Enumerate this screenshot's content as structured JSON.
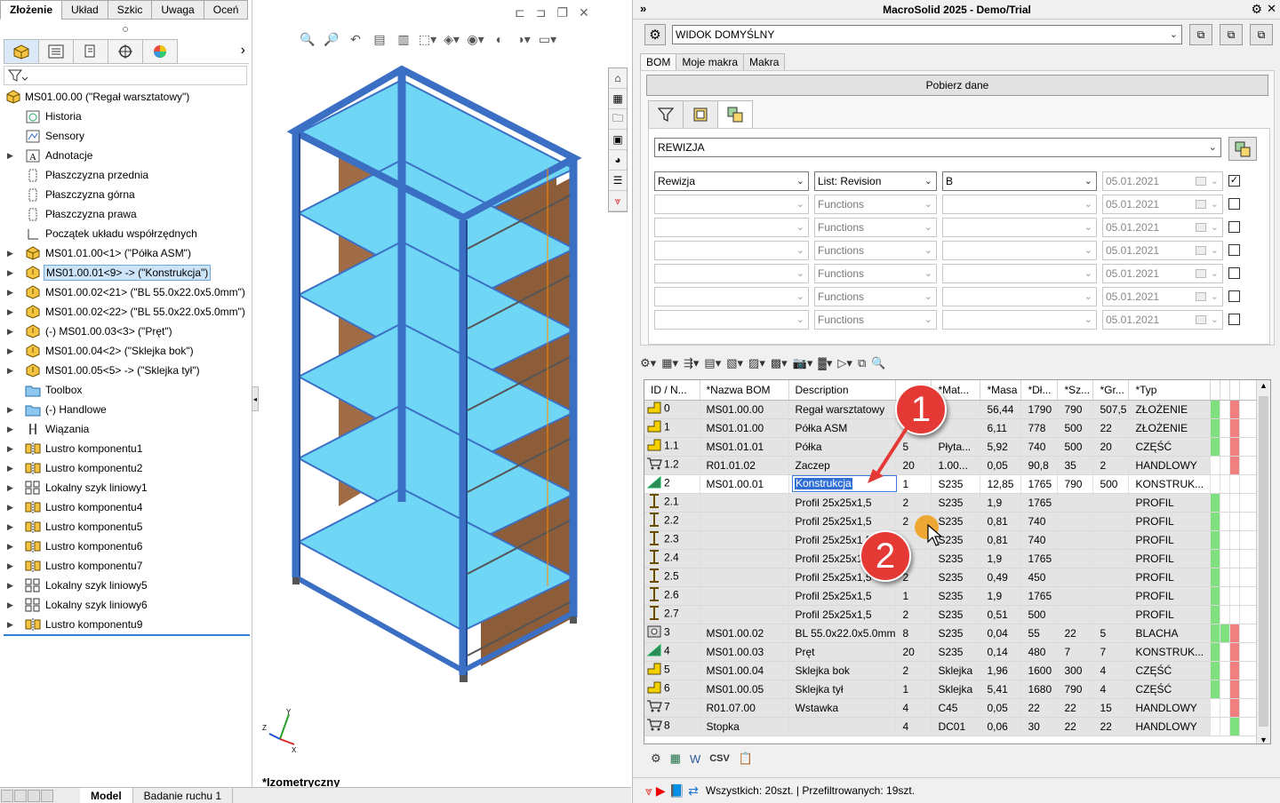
{
  "cmd_tabs": [
    "Złożenie",
    "Układ",
    "Szkic",
    "Uwaga",
    "Oceń"
  ],
  "tree": {
    "root": "MS01.00.00 (\"Regał warsztatowy\")",
    "items": [
      {
        "label": "Historia",
        "icon": "history-icon",
        "exp": ""
      },
      {
        "label": "Sensory",
        "icon": "sensor-icon",
        "exp": ""
      },
      {
        "label": "Adnotacje",
        "icon": "annotation-icon",
        "exp": "▶"
      },
      {
        "label": "Płaszczyzna przednia",
        "icon": "plane-icon",
        "exp": ""
      },
      {
        "label": "Płaszczyzna górna",
        "icon": "plane-icon",
        "exp": ""
      },
      {
        "label": "Płaszczyzna prawa",
        "icon": "plane-icon",
        "exp": ""
      },
      {
        "label": "Początek układu współrzędnych",
        "icon": "origin-icon",
        "exp": ""
      },
      {
        "label": "MS01.01.00<1> (\"Półka ASM\")",
        "icon": "assembly-icon",
        "exp": "▶"
      },
      {
        "label": "MS01.00.01<9> -> (\"Konstrukcja\")",
        "icon": "part-icon",
        "exp": "▶",
        "selected": true
      },
      {
        "label": "MS01.00.02<21> (\"BL 55.0x22.0x5.0mm\")",
        "icon": "part-icon",
        "exp": "▶"
      },
      {
        "label": "MS01.00.02<22> (\"BL 55.0x22.0x5.0mm\")",
        "icon": "part-icon",
        "exp": "▶"
      },
      {
        "label": "(-) MS01.00.03<3> (\"Pręt\")",
        "icon": "part-icon",
        "exp": "▶"
      },
      {
        "label": "MS01.00.04<2> (\"Sklejka bok\")",
        "icon": "part-icon",
        "exp": "▶"
      },
      {
        "label": "MS01.00.05<5> -> (\"Sklejka tył\")",
        "icon": "part-icon",
        "exp": "▶"
      },
      {
        "label": "Toolbox",
        "icon": "folder-icon",
        "exp": ""
      },
      {
        "label": "(-) Handlowe",
        "icon": "folder-icon",
        "exp": "▶"
      },
      {
        "label": "Wiązania",
        "icon": "mate-icon",
        "exp": "▶"
      },
      {
        "label": "Lustro komponentu1",
        "icon": "mirror-icon",
        "exp": "▶"
      },
      {
        "label": "Lustro komponentu2",
        "icon": "mirror-icon",
        "exp": "▶"
      },
      {
        "label": "Lokalny szyk liniowy1",
        "icon": "pattern-icon",
        "exp": "▶"
      },
      {
        "label": "Lustro komponentu4",
        "icon": "mirror-icon",
        "exp": "▶"
      },
      {
        "label": "Lustro komponentu5",
        "icon": "mirror-icon",
        "exp": "▶"
      },
      {
        "label": "Lustro komponentu6",
        "icon": "mirror-icon",
        "exp": "▶"
      },
      {
        "label": "Lustro komponentu7",
        "icon": "mirror-icon",
        "exp": "▶"
      },
      {
        "label": "Lokalny szyk liniowy5",
        "icon": "pattern-icon",
        "exp": "▶"
      },
      {
        "label": "Lokalny szyk liniowy6",
        "icon": "pattern-icon",
        "exp": "▶"
      },
      {
        "label": "Lustro komponentu9",
        "icon": "mirror-icon",
        "exp": "▶"
      }
    ]
  },
  "bottom_tabs": [
    "Model",
    "Badanie ruchu 1"
  ],
  "viewport": {
    "view_label": "*Izometryczny"
  },
  "panel": {
    "title": "MacroSolid 2025 - Demo/Trial",
    "view_combo": "WIDOK DOMYŚLNY",
    "tabs": [
      "BOM",
      "Moje makra",
      "Makra"
    ],
    "fetch_button": "Pobierz dane",
    "filter_combo": "REWIZJA",
    "filters": [
      {
        "field": "Rewizja",
        "op": "List: Revision",
        "value": "B",
        "date": "05.01.2021",
        "checked": true,
        "enabled": true
      },
      {
        "field": "",
        "op": "Functions",
        "value": "",
        "date": "05.01.2021",
        "checked": false,
        "enabled": false
      },
      {
        "field": "",
        "op": "Functions",
        "value": "",
        "date": "05.01.2021",
        "checked": false,
        "enabled": false
      },
      {
        "field": "",
        "op": "Functions",
        "value": "",
        "date": "05.01.2021",
        "checked": false,
        "enabled": false
      },
      {
        "field": "",
        "op": "Functions",
        "value": "",
        "date": "05.01.2021",
        "checked": false,
        "enabled": false
      },
      {
        "field": "",
        "op": "Functions",
        "value": "",
        "date": "05.01.2021",
        "checked": false,
        "enabled": false
      },
      {
        "field": "",
        "op": "Functions",
        "value": "",
        "date": "05.01.2021",
        "checked": false,
        "enabled": false
      }
    ],
    "grid": {
      "columns": [
        "ID / N...",
        "*Nazwa BOM",
        "Description",
        "",
        "*Mat...",
        "*Masa",
        "*Dł...",
        "*Sz...",
        "*Gr...",
        "*Typ"
      ],
      "rows": [
        {
          "icon": "part-icon",
          "id": "0",
          "name": "MS01.00.00",
          "desc": "Regał warsztatowy",
          "qty": "",
          "mat": "",
          "mass": "56,44",
          "len": "1790",
          "wid": "790",
          "thk": "507,5",
          "type": "ZŁOŻENIE",
          "s1": "g",
          "s2": "w",
          "s3": "r"
        },
        {
          "icon": "part-icon",
          "id": "1",
          "name": "MS01.01.00",
          "desc": "Półka ASM",
          "qty": "",
          "mat": "",
          "mass": "6,11",
          "len": "778",
          "wid": "500",
          "thk": "22",
          "type": "ZŁOŻENIE",
          "s1": "g",
          "s2": "w",
          "s3": "r"
        },
        {
          "icon": "part-icon",
          "id": "1.1",
          "name": "MS01.01.01",
          "desc": "Półka",
          "qty": "5",
          "mat": "Płyta...",
          "mass": "5,92",
          "len": "740",
          "wid": "500",
          "thk": "20",
          "type": "CZĘŚĆ",
          "s1": "g",
          "s2": "w",
          "s3": "r"
        },
        {
          "icon": "cart-icon",
          "id": "1.2",
          "name": "R01.01.02",
          "desc": "Zaczep",
          "qty": "20",
          "mat": "1.00...",
          "mass": "0,05",
          "len": "90,8",
          "wid": "35",
          "thk": "2",
          "type": "HANDLOWY",
          "s1": "w",
          "s2": "w",
          "s3": "r"
        },
        {
          "icon": "weldment-icon",
          "id": "2",
          "name": "MS01.00.01",
          "desc": "Konstrukcja",
          "qty": "1",
          "mat": "S235",
          "mass": "12,85",
          "len": "1765",
          "wid": "790",
          "thk": "500",
          "type": "KONSTRUK...",
          "s1": "w",
          "s2": "w",
          "s3": "w",
          "edit": true
        },
        {
          "icon": "beam-icon",
          "id": "2.1",
          "name": "",
          "desc": "Profil 25x25x1,5",
          "qty": "2",
          "mat": "S235",
          "mass": "1,9",
          "len": "1765",
          "wid": "",
          "thk": "",
          "type": "PROFIL",
          "s1": "g",
          "s2": "w",
          "s3": "w"
        },
        {
          "icon": "beam-icon",
          "id": "2.2",
          "name": "",
          "desc": "Profil 25x25x1,5",
          "qty": "2",
          "mat": "S235",
          "mass": "0,81",
          "len": "740",
          "wid": "",
          "thk": "",
          "type": "PROFIL",
          "s1": "g",
          "s2": "w",
          "s3": "w"
        },
        {
          "icon": "beam-icon",
          "id": "2.3",
          "name": "",
          "desc": "Profil 25x25x1,5",
          "qty": "",
          "mat": "S235",
          "mass": "0,81",
          "len": "740",
          "wid": "",
          "thk": "",
          "type": "PROFIL",
          "s1": "g",
          "s2": "w",
          "s3": "w"
        },
        {
          "icon": "beam-icon",
          "id": "2.4",
          "name": "",
          "desc": "Profil 25x25x1,",
          "qty": "",
          "mat": "S235",
          "mass": "1,9",
          "len": "1765",
          "wid": "",
          "thk": "",
          "type": "PROFIL",
          "s1": "g",
          "s2": "w",
          "s3": "w"
        },
        {
          "icon": "beam-icon",
          "id": "2.5",
          "name": "",
          "desc": "Profil 25x25x1,5",
          "qty": "2",
          "mat": "S235",
          "mass": "0,49",
          "len": "450",
          "wid": "",
          "thk": "",
          "type": "PROFIL",
          "s1": "g",
          "s2": "w",
          "s3": "w"
        },
        {
          "icon": "beam-icon",
          "id": "2.6",
          "name": "",
          "desc": "Profil 25x25x1,5",
          "qty": "1",
          "mat": "S235",
          "mass": "1,9",
          "len": "1765",
          "wid": "",
          "thk": "",
          "type": "PROFIL",
          "s1": "g",
          "s2": "w",
          "s3": "w"
        },
        {
          "icon": "beam-icon",
          "id": "2.7",
          "name": "",
          "desc": "Profil 25x25x1,5",
          "qty": "2",
          "mat": "S235",
          "mass": "0,51",
          "len": "500",
          "wid": "",
          "thk": "",
          "type": "PROFIL",
          "s1": "g",
          "s2": "w",
          "s3": "w"
        },
        {
          "icon": "sheet-icon",
          "id": "3",
          "name": "MS01.00.02",
          "desc": "BL 55.0x22.0x5.0mm",
          "qty": "8",
          "mat": "S235",
          "mass": "0,04",
          "len": "55",
          "wid": "22",
          "thk": "5",
          "type": "BLACHA",
          "s1": "g",
          "s2": "g",
          "s3": "r"
        },
        {
          "icon": "weldment-icon",
          "id": "4",
          "name": "MS01.00.03",
          "desc": "Pręt",
          "qty": "20",
          "mat": "S235",
          "mass": "0,14",
          "len": "480",
          "wid": "7",
          "thk": "7",
          "type": "KONSTRUK...",
          "s1": "g",
          "s2": "w",
          "s3": "r"
        },
        {
          "icon": "part-icon",
          "id": "5",
          "name": "MS01.00.04",
          "desc": "Sklejka bok",
          "qty": "2",
          "mat": "Sklejka",
          "mass": "1,96",
          "len": "1600",
          "wid": "300",
          "thk": "4",
          "type": "CZĘŚĆ",
          "s1": "g",
          "s2": "w",
          "s3": "r"
        },
        {
          "icon": "part-icon",
          "id": "6",
          "name": "MS01.00.05",
          "desc": "Sklejka tył",
          "qty": "1",
          "mat": "Sklejka",
          "mass": "5,41",
          "len": "1680",
          "wid": "790",
          "thk": "4",
          "type": "CZĘŚĆ",
          "s1": "g",
          "s2": "w",
          "s3": "r"
        },
        {
          "icon": "cart-icon",
          "id": "7",
          "name": "R01.07.00",
          "desc": "Wstawka",
          "qty": "4",
          "mat": "C45",
          "mass": "0,05",
          "len": "22",
          "wid": "22",
          "thk": "15",
          "type": "HANDLOWY",
          "s1": "w",
          "s2": "w",
          "s3": "r"
        },
        {
          "icon": "cart-icon",
          "id": "8",
          "name": "Stopka",
          "desc": "",
          "qty": "4",
          "mat": "DC01",
          "mass": "0,06",
          "len": "30",
          "wid": "22",
          "thk": "22",
          "type": "HANDLOWY",
          "s1": "w",
          "s2": "w",
          "s3": "g"
        }
      ],
      "edit_value": "Konstrukcja"
    },
    "bottom_csv": "CSV",
    "status": "Wszystkich: 20szt. | Przefiltrowanych: 19szt."
  },
  "callouts": [
    "1",
    "2"
  ],
  "colors": {
    "green": "#7ee07e",
    "red": "#f08080",
    "frame": "#3a6fc4",
    "shelf": "#6fd6f6",
    "wood": "#9a6a44"
  }
}
